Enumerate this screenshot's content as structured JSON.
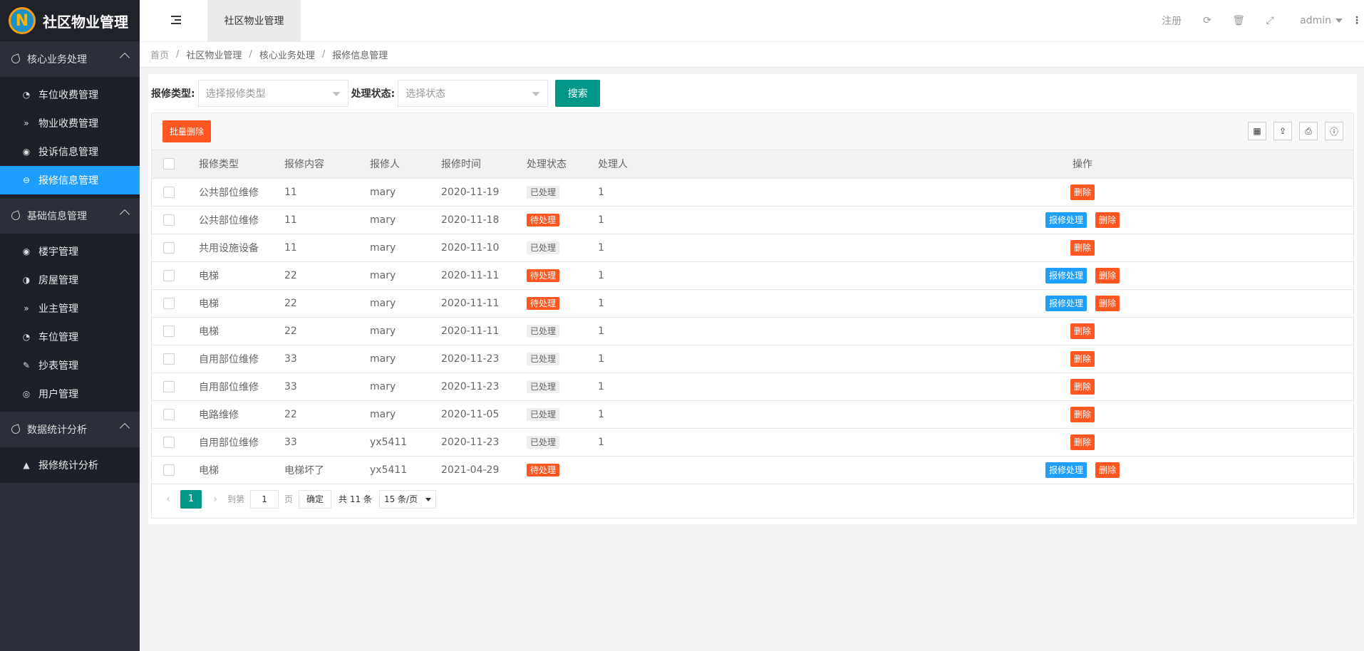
{
  "app": {
    "title": "社区物业管理"
  },
  "sidebar": {
    "groups": [
      {
        "title": "核心业务处理",
        "items": [
          {
            "label": "车位收费管理",
            "icon": "dashboard-icon"
          },
          {
            "label": "物业收费管理",
            "icon": "double-chevron-down-icon"
          },
          {
            "label": "投诉信息管理",
            "icon": "target-icon"
          },
          {
            "label": "报修信息管理",
            "icon": "circle-minus-icon",
            "active": true
          }
        ]
      },
      {
        "title": "基础信息管理",
        "items": [
          {
            "label": "楼宇管理",
            "icon": "target-icon"
          },
          {
            "label": "房屋管理",
            "icon": "circle-icon"
          },
          {
            "label": "业主管理",
            "icon": "double-chevron-down-icon"
          },
          {
            "label": "车位管理",
            "icon": "dashboard-icon"
          },
          {
            "label": "抄表管理",
            "icon": "edit-icon"
          },
          {
            "label": "用户管理",
            "icon": "user-circle-icon"
          }
        ]
      },
      {
        "title": "数据统计分析",
        "items": [
          {
            "label": "报修统计分析",
            "icon": "area-chart-icon"
          }
        ]
      }
    ]
  },
  "header": {
    "tab": "社区物业管理",
    "register": "注册",
    "user": "admin"
  },
  "breadcrumb": [
    "首页",
    "社区物业管理",
    "核心业务处理",
    "报修信息管理"
  ],
  "search": {
    "type_label": "报修类型:",
    "type_placeholder": "选择报修类型",
    "state_label": "处理状态:",
    "state_placeholder": "选择状态",
    "button": "搜索"
  },
  "toolbar": {
    "batch_delete": "批量删除"
  },
  "table": {
    "headers": {
      "type": "报修类型",
      "content": "报修内容",
      "user": "报修人",
      "time": "报修时间",
      "state": "处理状态",
      "handler": "处理人",
      "op": "操作"
    },
    "op_handle": "报修处理",
    "op_delete": "删除",
    "rows": [
      {
        "type": "公共部位维修",
        "content": "11",
        "user": "mary",
        "time": "2020-11-19",
        "state": "已处理",
        "pending": false,
        "handler": "1"
      },
      {
        "type": "公共部位维修",
        "content": "11",
        "user": "mary",
        "time": "2020-11-18",
        "state": "待处理",
        "pending": true,
        "handler": "1"
      },
      {
        "type": "共用设施设备",
        "content": "11",
        "user": "mary",
        "time": "2020-11-10",
        "state": "已处理",
        "pending": false,
        "handler": "1"
      },
      {
        "type": "电梯",
        "content": "22",
        "user": "mary",
        "time": "2020-11-11",
        "state": "待处理",
        "pending": true,
        "handler": "1"
      },
      {
        "type": "电梯",
        "content": "22",
        "user": "mary",
        "time": "2020-11-11",
        "state": "待处理",
        "pending": true,
        "handler": "1"
      },
      {
        "type": "电梯",
        "content": "22",
        "user": "mary",
        "time": "2020-11-11",
        "state": "已处理",
        "pending": false,
        "handler": "1"
      },
      {
        "type": "自用部位维修",
        "content": "33",
        "user": "mary",
        "time": "2020-11-23",
        "state": "已处理",
        "pending": false,
        "handler": "1"
      },
      {
        "type": "自用部位维修",
        "content": "33",
        "user": "mary",
        "time": "2020-11-23",
        "state": "已处理",
        "pending": false,
        "handler": "1"
      },
      {
        "type": "电路维修",
        "content": "22",
        "user": "mary",
        "time": "2020-11-05",
        "state": "已处理",
        "pending": false,
        "handler": "1"
      },
      {
        "type": "自用部位维修",
        "content": "33",
        "user": "yx5411",
        "time": "2020-11-23",
        "state": "已处理",
        "pending": false,
        "handler": "1"
      },
      {
        "type": "电梯",
        "content": "电梯坏了",
        "user": "yx5411",
        "time": "2021-04-29",
        "state": "待处理",
        "pending": true,
        "handler": ""
      }
    ]
  },
  "pager": {
    "current": "1",
    "goto_label": "到第",
    "page_value": "1",
    "page_unit": "页",
    "confirm": "确定",
    "total": "共 11 条",
    "page_size": "15 条/页"
  },
  "colors": {
    "accent": "#009688",
    "danger": "#ff5722",
    "info": "#1e9fff",
    "sidebar": "#2a2f39"
  }
}
